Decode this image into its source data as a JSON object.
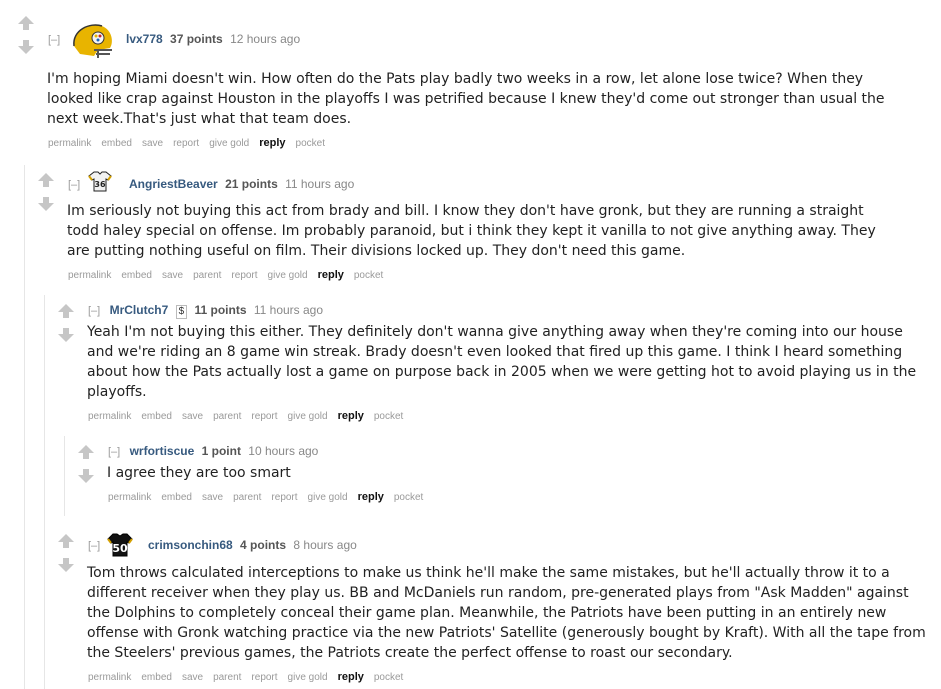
{
  "comments": [
    {
      "expand": "[–]",
      "author": "lvx778",
      "score": "37 points",
      "time": "12 hours ago",
      "avatar_icon": "steelers-helmet-icon",
      "body": "I'm hoping Miami doesn't win. How often do the Pats play badly two weeks in a row, let alone lose twice? When they looked like crap against Houston in the playoffs I was petrified because I knew they'd come out stronger than usual the next week.That's just what that team does.",
      "buttons": {
        "permalink": "permalink",
        "embed": "embed",
        "save": "save",
        "report": "report",
        "give_gold": "give gold",
        "reply": "reply",
        "pocket": "pocket"
      }
    },
    {
      "expand": "[–]",
      "author": "AngriestBeaver",
      "score": "21 points",
      "time": "11 hours ago",
      "avatar_icon": "jersey-36-icon",
      "avatar_text": "36",
      "body": "Im seriously not buying this act from brady and bill. I know they don't have gronk, but they are running a straight todd haley special on offense. Im probably paranoid, but i think they kept it vanilla to not give anything away. They are putting nothing useful on film. Their divisions locked up. They don't need this game.",
      "buttons": {
        "permalink": "permalink",
        "embed": "embed",
        "save": "save",
        "parent": "parent",
        "report": "report",
        "give_gold": "give gold",
        "reply": "reply",
        "pocket": "pocket"
      }
    },
    {
      "expand": "[–]",
      "author": "MrClutch7",
      "flair": "$",
      "score": "11 points",
      "time": "11 hours ago",
      "body": "Yeah I'm not buying this either. They definitely don't wanna give anything away when they're coming into our house and we're riding an 8 game win streak. Brady doesn't even looked that fired up this game. I think I heard something about how the Pats actually lost a game on purpose back in 2005 when we were getting hot to avoid playing us in the playoffs.",
      "buttons": {
        "permalink": "permalink",
        "embed": "embed",
        "save": "save",
        "parent": "parent",
        "report": "report",
        "give_gold": "give gold",
        "reply": "reply",
        "pocket": "pocket"
      }
    },
    {
      "expand": "[–]",
      "author": "wrfortiscue",
      "score": "1 point",
      "time": "10 hours ago",
      "body": "I agree they are too smart",
      "buttons": {
        "permalink": "permalink",
        "embed": "embed",
        "save": "save",
        "parent": "parent",
        "report": "report",
        "give_gold": "give gold",
        "reply": "reply",
        "pocket": "pocket"
      }
    },
    {
      "expand": "[–]",
      "author": "crimsonchin68",
      "score": "4 points",
      "time": "8 hours ago",
      "avatar_icon": "jersey-50-icon",
      "avatar_text": "50",
      "body": "Tom throws calculated interceptions to make us think he'll make the same mistakes, but he'll actually throw it to a different receiver when they play us. BB and McDaniels run random, pre-generated plays from \"Ask Madden\" against the Dolphins to completely conceal their game plan. Meanwhile, the Patriots have been putting in an entirely new offense with Gronk watching practice via the new Patriots' Satellite (generously bought by Kraft). With all the tape from the Steelers' previous games, the Patriots create the perfect offense to roast our secondary.",
      "buttons": {
        "permalink": "permalink",
        "embed": "embed",
        "save": "save",
        "parent": "parent",
        "report": "report",
        "give_gold": "give gold",
        "reply": "reply",
        "pocket": "pocket"
      }
    }
  ],
  "colors": {
    "upvote": "#c6c6c6",
    "downvote": "#c6c6c6",
    "author": "#375a7f"
  }
}
